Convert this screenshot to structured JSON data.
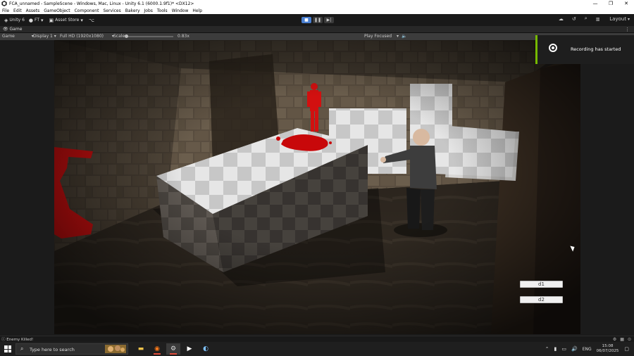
{
  "window": {
    "title": "FCA_unnamed - SampleScene - Windows, Mac, Linux - Unity 6.1 (6000.1.9f1)* <DX12>",
    "controls": [
      "—",
      "❐",
      "✕"
    ]
  },
  "menu": [
    "File",
    "Edit",
    "Assets",
    "GameObject",
    "Component",
    "Services",
    "Bakery",
    "Jobs",
    "Tools",
    "Window",
    "Help"
  ],
  "toolbar": {
    "account": "Unity 6",
    "user": "FT",
    "asset_store": "Asset Store",
    "layout": "Layout"
  },
  "game_tab": {
    "label": "Game"
  },
  "game_bar": {
    "mode": "Game",
    "display": "Display 1",
    "resolution": "Full HD (1920x1080)",
    "scale_label": "Scale",
    "scale_value": "0.83x",
    "play_mode": "Play Focused"
  },
  "notification": {
    "text": "Recording has started"
  },
  "game_ui": {
    "button1": "d1",
    "button2": "d2"
  },
  "status": {
    "message": "Enemy Killed!"
  },
  "taskbar": {
    "search_placeholder": "Type here to search",
    "language": "ENG",
    "time": "15:08",
    "date": "06/07/2025"
  }
}
